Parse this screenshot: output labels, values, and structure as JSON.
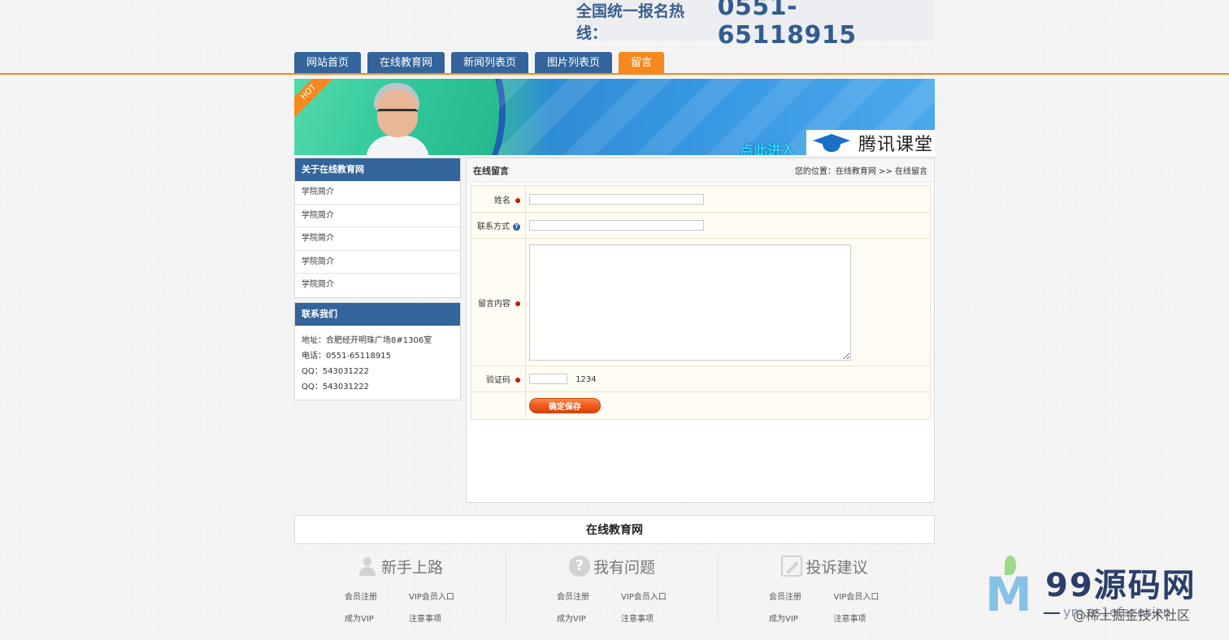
{
  "header": {
    "hotline_label": "全国统一报名热线：",
    "hotline_number": "0551-65118915"
  },
  "nav": {
    "tabs": [
      {
        "label": "网站首页"
      },
      {
        "label": "在线教育网"
      },
      {
        "label": "新闻列表页"
      },
      {
        "label": "图片列表页"
      },
      {
        "label": "留言",
        "active": true
      }
    ],
    "accent_color": "#f5891e",
    "primary_color": "#33649b"
  },
  "banner": {
    "ribbon": "HOT",
    "cta": "点此进入",
    "brand": "腾讯课堂"
  },
  "sidebar": {
    "about": {
      "title": "关于在线教育网",
      "items": [
        "学院简介",
        "学院简介",
        "学院简介",
        "学院简介",
        "学院简介"
      ]
    },
    "contact": {
      "title": "联系我们",
      "address": "地址：合肥经开明珠广场8#1306室",
      "phone": "电话：0551-65118915",
      "qq1": "QQ：543031222",
      "qq2": "QQ：543031222"
    }
  },
  "main": {
    "title": "在线留言",
    "breadcrumb": {
      "prefix": "您的位置：",
      "home": "在线教育网",
      "sep": " >> ",
      "current": "在线留言"
    },
    "form": {
      "name_label": "姓名",
      "name_value": "",
      "contact_label": "联系方式",
      "contact_value": "",
      "content_label": "留言内容",
      "content_value": "",
      "captcha_label": "验证码",
      "captcha_value": "",
      "captcha_code": "1234",
      "submit_label": "确定保存"
    }
  },
  "footer": {
    "site_name": "在线教育网",
    "columns": [
      {
        "title": "新手上路",
        "icon": "user-icon",
        "links": [
          "会员注册",
          "VIP会员入口",
          "成为VIP",
          "注意事项"
        ]
      },
      {
        "title": "我有问题",
        "icon": "question-icon",
        "links": [
          "会员注册",
          "VIP会员入口",
          "成为VIP",
          "注意事项"
        ]
      },
      {
        "title": "投诉建议",
        "icon": "edit-icon",
        "links": [
          "会员注册",
          "VIP会员入口",
          "成为VIP",
          "注意事项"
        ]
      }
    ]
  },
  "watermark": {
    "logo_letter": "M",
    "title": "99源码网",
    "url": "ym.ss1ofacesicn",
    "community": "@稀土掘金技术社区"
  }
}
